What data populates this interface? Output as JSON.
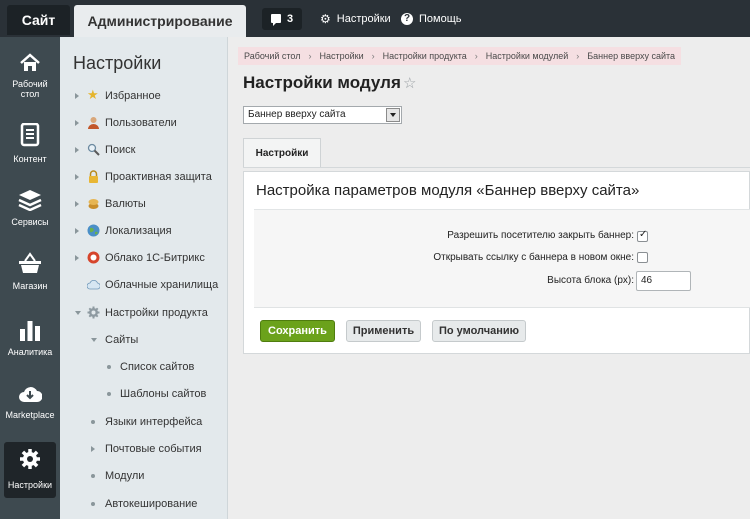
{
  "topbar": {
    "site_tab": "Сайт",
    "admin_tab": "Администрирование",
    "notifications_count": "3",
    "settings_link": "Настройки",
    "help_link": "Помощь"
  },
  "leftnav": {
    "items": [
      {
        "label_line1": "Рабочий",
        "label_line2": "стол",
        "icon": "home-icon"
      },
      {
        "label_line1": "Контент",
        "label_line2": "",
        "icon": "document-icon"
      },
      {
        "label_line1": "Сервисы",
        "label_line2": "",
        "icon": "layers-icon"
      },
      {
        "label_line1": "Магазин",
        "label_line2": "",
        "icon": "basket-icon"
      },
      {
        "label_line1": "Аналитика",
        "label_line2": "",
        "icon": "bar-chart-icon"
      },
      {
        "label_line1": "Marketplace",
        "label_line2": "",
        "icon": "cloud-download-icon"
      },
      {
        "label_line1": "Настройки",
        "label_line2": "",
        "icon": "gear-icon"
      }
    ]
  },
  "panel": {
    "title": "Настройки",
    "items": [
      {
        "label": "Избранное"
      },
      {
        "label": "Пользователи"
      },
      {
        "label": "Поиск"
      },
      {
        "label": "Проактивная защита"
      },
      {
        "label": "Валюты"
      },
      {
        "label": "Локализация"
      },
      {
        "label": "Облако 1С-Битрикс"
      },
      {
        "label": "Облачные хранилища"
      },
      {
        "label": "Настройки продукта"
      },
      {
        "label": "Сайты"
      },
      {
        "label": "Список сайтов"
      },
      {
        "label": "Шаблоны сайтов"
      },
      {
        "label": "Языки интерфейса"
      },
      {
        "label": "Почтовые события"
      },
      {
        "label": "Модули"
      },
      {
        "label": "Автокеширование"
      }
    ]
  },
  "breadcrumbs": [
    "Рабочий стол",
    "Настройки",
    "Настройки продукта",
    "Настройки модулей",
    "Баннер вверху сайта"
  ],
  "main": {
    "title": "Настройки модуля",
    "module_select_value": "Баннер вверху сайта",
    "tab_label": "Настройки",
    "card_title": "Настройка параметров модуля «Баннер вверху сайта»",
    "fields": {
      "allow_close_label": "Разрешить посетителю закрыть баннер:",
      "allow_close_checked": true,
      "open_new_window_label": "Открывать ссылку с баннера в новом окне:",
      "open_new_window_checked": false,
      "height_label": "Высота блока (px):",
      "height_value": "46"
    },
    "buttons": {
      "save": "Сохранить",
      "apply": "Применить",
      "default": "По умолчанию"
    }
  },
  "colors": {
    "topbar_bg": "#2a3137",
    "leftnav_bg": "#3e4a50",
    "save_green": "#6ba21b",
    "breadcrumb_bg": "#f5dfe2"
  }
}
